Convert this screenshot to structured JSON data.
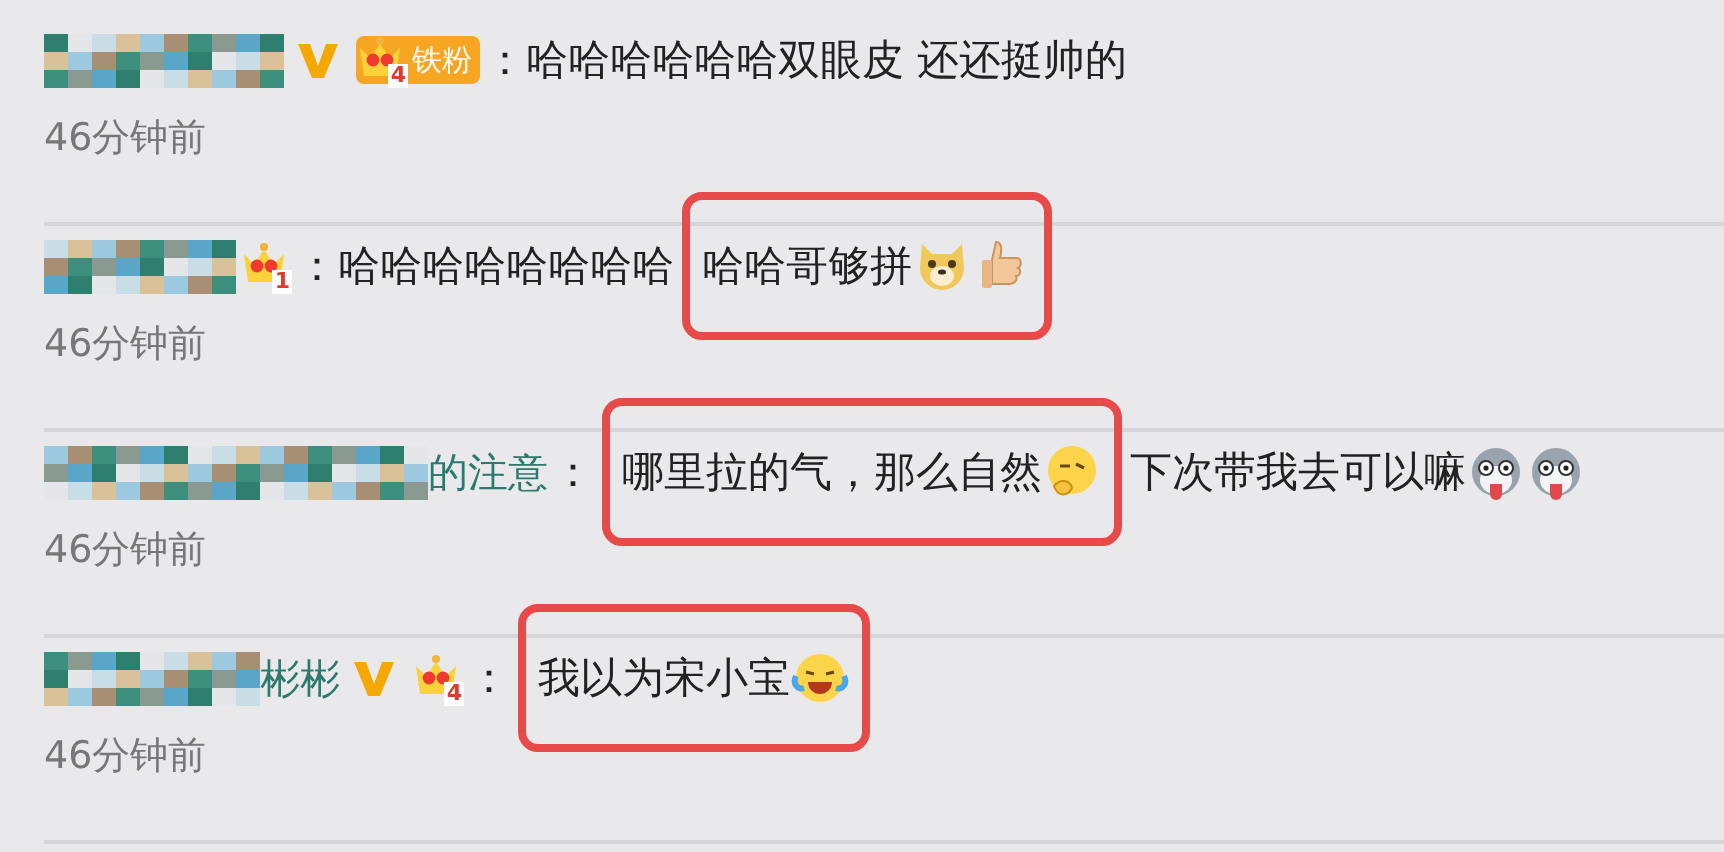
{
  "comments": [
    {
      "verified": true,
      "crown": {
        "level": "4"
      },
      "fan_tag": "铁粉",
      "separator": "：",
      "segments": [
        {
          "text": "哈哈哈哈哈哈双眼皮 还还挺帅的",
          "highlighted": false
        }
      ],
      "time": "46分钟前"
    },
    {
      "verified": false,
      "crown": {
        "level": "1"
      },
      "separator": "：",
      "segments": [
        {
          "text": "哈哈哈哈哈哈哈哈",
          "highlighted": false
        },
        {
          "text": "哈哈哥够拼",
          "emojis": [
            {
              "kind": "doge"
            },
            {
              "kind": "thumbs-up"
            }
          ],
          "highlighted": true
        }
      ],
      "time": "46分钟前"
    },
    {
      "name_visible": "的注意",
      "verified": false,
      "separator": "：",
      "segments": [
        {
          "text": "哪里拉的气，那么自然",
          "emojis": [
            {
              "kind": "thinking"
            }
          ],
          "highlighted": true
        },
        {
          "text": "下次带我去可以嘛",
          "emojis": [
            {
              "kind": "husky"
            },
            {
              "kind": "husky"
            }
          ],
          "highlighted": false
        }
      ],
      "time": "46分钟前"
    },
    {
      "name_visible": "彬彬",
      "verified": true,
      "crown": {
        "level": "4"
      },
      "separator": "：",
      "segments": [
        {
          "text": "我以为宋小宝",
          "emojis": [
            {
              "kind": "laugh-cry"
            }
          ],
          "highlighted": true
        }
      ],
      "time": "46分钟前"
    }
  ]
}
